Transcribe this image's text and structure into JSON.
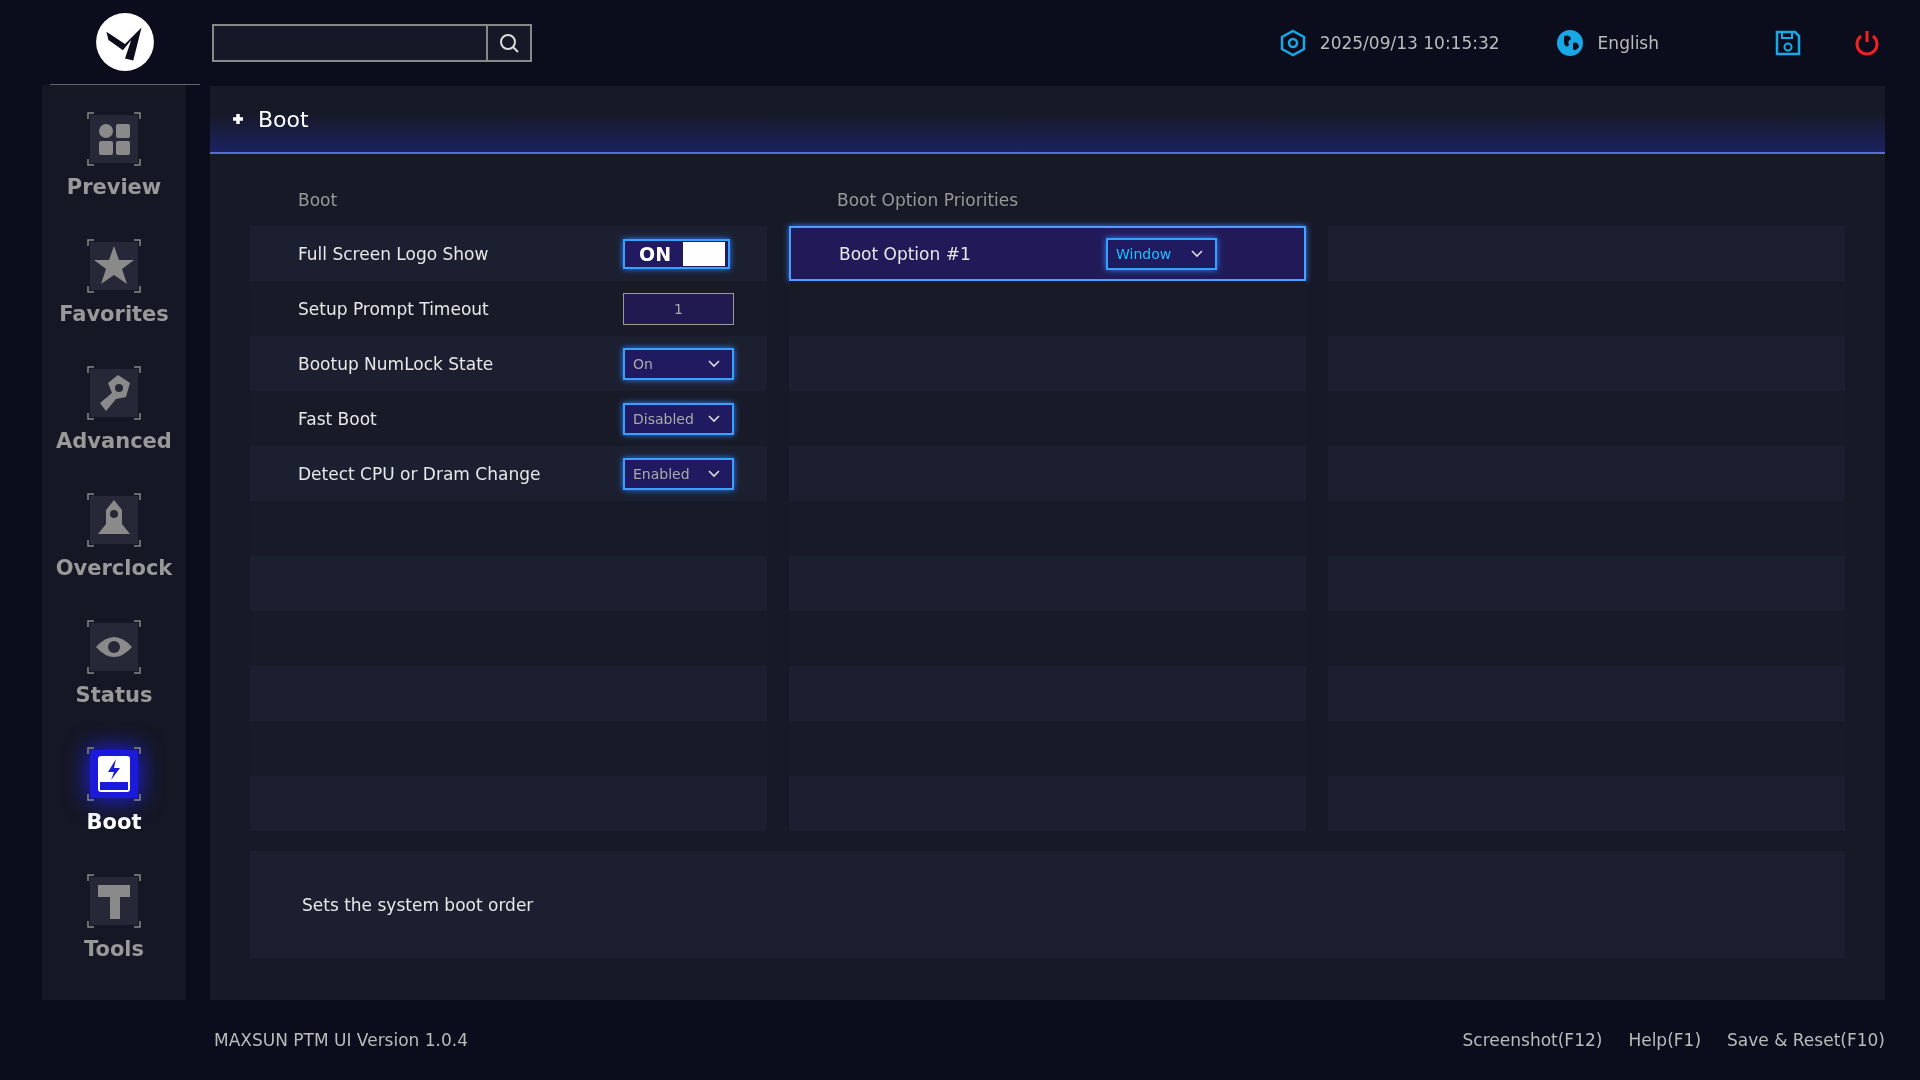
{
  "top_bar": {
    "datetime": "2025/09/13 10:15:32",
    "language": "English"
  },
  "sidebar": {
    "items": [
      {
        "label": "Preview",
        "selected": false
      },
      {
        "label": "Favorites",
        "selected": false
      },
      {
        "label": "Advanced",
        "selected": false
      },
      {
        "label": "Overclock",
        "selected": false
      },
      {
        "label": "Status",
        "selected": false
      },
      {
        "label": "Boot",
        "selected": true
      },
      {
        "label": "Tools",
        "selected": false
      }
    ]
  },
  "page": {
    "title": "Boot"
  },
  "settings": {
    "heading": "Boot",
    "rows": [
      {
        "label": "Full Screen Logo Show",
        "kind": "toggle",
        "value": "ON",
        "on": true
      },
      {
        "label": "Setup Prompt Timeout",
        "kind": "number",
        "value": "1"
      },
      {
        "label": "Bootup NumLock State",
        "kind": "dropdown",
        "value": "On"
      },
      {
        "label": "Fast Boot",
        "kind": "dropdown",
        "value": "Disabled"
      },
      {
        "label": "Detect CPU or Dram Change",
        "kind": "dropdown",
        "value": "Enabled"
      }
    ]
  },
  "boot_priorities": {
    "heading": "Boot Option Priorities",
    "rows": [
      {
        "label": "Boot Option #1",
        "value": "Window",
        "selected": true
      }
    ]
  },
  "description": "Sets the system boot order",
  "footer": {
    "version": "MAXSUN PTM UI Version 1.0.4",
    "actions": [
      "Screenshot(F12)",
      "Help(F1)",
      "Save & Reset(F10)"
    ]
  }
}
